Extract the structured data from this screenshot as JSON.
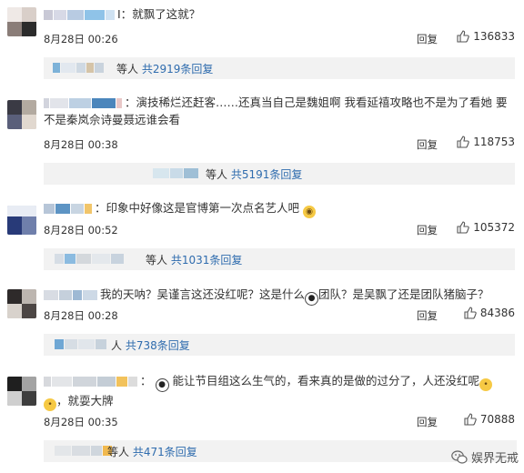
{
  "comments": [
    {
      "name": "Ⅰ：",
      "text": "就飘了这就？",
      "date": "8月28日 00:26",
      "reply_label": "回复",
      "likes": "136833",
      "replies_who": "等人",
      "replies_count": "共2919条回复"
    },
    {
      "name": "：",
      "text": "演技稀烂还赶客……还真当自己是魏姐啊 我看延禧攻略也不是为了看她 要不是秦岚佘诗曼聂远谁会看",
      "date": "8月28日 00:38",
      "reply_label": "回复",
      "likes": "118753",
      "replies_who": "等人",
      "replies_count": "共5191条回复"
    },
    {
      "name": "：",
      "text": "印象中好像这是官博第一次点名艺人吧",
      "date": "8月28日 00:52",
      "reply_label": "回复",
      "likes": "105372",
      "replies_who": "等人",
      "replies_count": "共1031条回复"
    },
    {
      "name": "：",
      "text_a": "我的天呐？吴谨言这还没红呢？这是什么",
      "text_b": "团队？是吴飘了还是团队猪脑子？",
      "date": "8月28日 00:28",
      "reply_label": "回复",
      "likes": "84386",
      "replies_who": "人",
      "replies_count": "共738条回复"
    },
    {
      "name": "：",
      "text_a": "能让节目组这么生气的，看来真的是做的过分了，人还没红呢",
      "text_b": "，就耍大牌",
      "date": "8月28日 00:35",
      "reply_label": "回复",
      "likes": "70888",
      "replies_who": "等人",
      "replies_count": "共471条回复"
    }
  ],
  "watermark": "娱界无戒",
  "colors": {
    "link_blue": "#2f6cae",
    "reply_bg": "#f2f2f2",
    "text": "#333333"
  }
}
